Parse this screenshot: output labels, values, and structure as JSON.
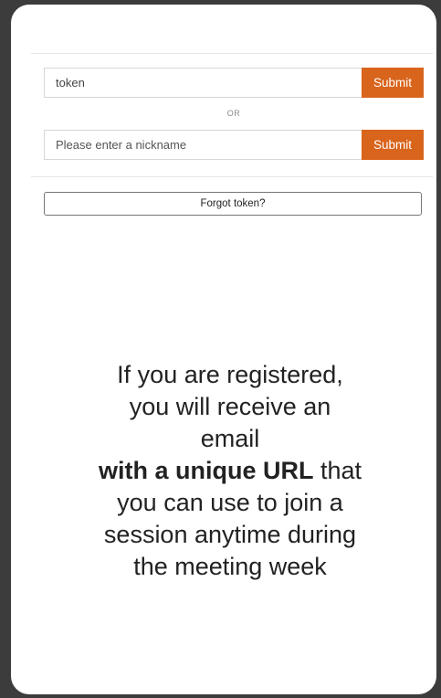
{
  "login": {
    "token_value": "token",
    "token_submit_label": "Submit",
    "or_label": "OR",
    "nickname_placeholder": "Please enter a nickname",
    "nickname_submit_label": "Submit",
    "forgot_label": "Forgot token?"
  },
  "message": {
    "line1": "If you are registered,",
    "line2": "you will receive an",
    "line3": "email",
    "line4_bold": "with a unique URL",
    "line4_rest": " that",
    "line5": "you can use to join a",
    "line6": "session anytime during",
    "line7": "the meeting week"
  },
  "colors": {
    "accent": "#d9641c",
    "background": "#3c3c3c",
    "card": "#ffffff"
  }
}
